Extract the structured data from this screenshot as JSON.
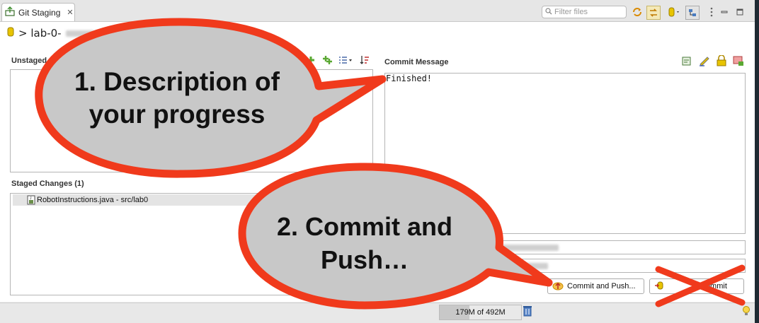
{
  "view": {
    "tab_title": "Git Staging",
    "filter_placeholder": "Filter files"
  },
  "repo": {
    "path_prefix": "> lab-0-"
  },
  "unstaged": {
    "label": "Unstaged C"
  },
  "staged": {
    "label": "Staged Changes (1)",
    "files": [
      {
        "name": "RobotInstructions.java - src/lab0"
      }
    ]
  },
  "commit": {
    "label": "Commit Message",
    "message": "Finished!",
    "commit_and_push_label": "Commit and Push...",
    "commit_label": "Commit"
  },
  "status_bar": {
    "heap": "179M of 492M",
    "heap_used_fraction": 0.364
  },
  "annotations": {
    "bubble1_line1": "1. Description of",
    "bubble1_line2": "your progress",
    "bubble2_line1": "2. Commit and",
    "bubble2_line2": "Push…"
  },
  "colors": {
    "callout_fill": "#c8c8c8",
    "callout_stroke": "#f03a1c",
    "cross": "#f03a1c"
  },
  "icons": {
    "tab": "git-staging-icon",
    "search": "search-icon",
    "repo": "repository-icon"
  }
}
